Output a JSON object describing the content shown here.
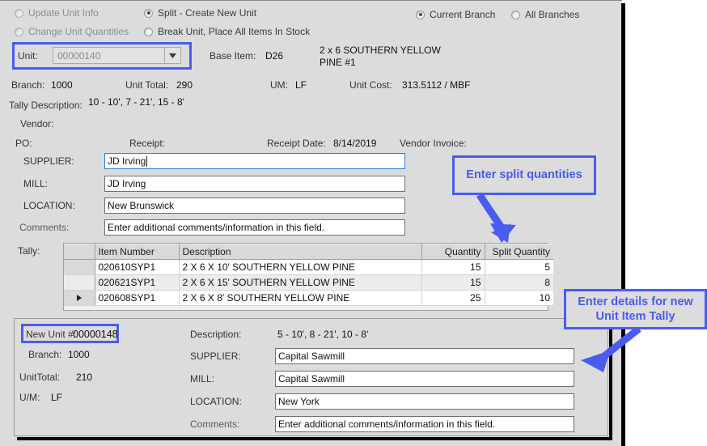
{
  "accent_color": "#4a5cf0",
  "mode_options": {
    "update_unit_info": "Update Unit Info",
    "change_unit_quantities": "Change Unit Quantities",
    "split_create_new_unit": "Split - Create New Unit",
    "break_unit": "Break Unit, Place All Items In Stock"
  },
  "branch_scope": {
    "current_branch": "Current Branch",
    "all_branches": "All Branches"
  },
  "unit_section": {
    "unit_label": "Unit:",
    "unit_value": "00000140",
    "base_item_label": "Base Item:",
    "base_item_value": "D26",
    "item_desc_line1": "2 x 6 SOUTHERN YELLOW",
    "item_desc_line2": "PINE #1"
  },
  "info_row": {
    "branch_label": "Branch:",
    "branch_value": "1000",
    "unit_total_label": "Unit Total:",
    "unit_total_value": "290",
    "um_label": "UM:",
    "um_value": "LF",
    "unit_cost_label": "Unit Cost:",
    "unit_cost_value": "313.5112 / MBF"
  },
  "tally_description": {
    "label": "Tally Description:",
    "value": "10 - 10', 7 - 21', 15 - 8'"
  },
  "vendor": {
    "vendor_label": "Vendor:",
    "po_label": "PO:",
    "po_value": "",
    "receipt_label": "Receipt:",
    "receipt_value": "",
    "receipt_date_label": "Receipt Date:",
    "receipt_date_value": "8/14/2019",
    "vendor_invoice_label": "Vendor Invoice:",
    "vendor_invoice_value": ""
  },
  "source_fields": {
    "supplier_label": "SUPPLIER:",
    "supplier_value": "JD Irving",
    "mill_label": "MILL:",
    "mill_value": "JD Irving",
    "location_label": "LOCATION:",
    "location_value": "New Brunswick",
    "comments_label": "Comments:",
    "comments_value": "Enter additional comments/information in this field."
  },
  "tally": {
    "label": "Tally:",
    "columns": [
      "",
      "Item Number",
      "Description",
      "Quantity",
      "Split Quantity"
    ],
    "rows": [
      {
        "selector": "",
        "item_number": "020610SYP1",
        "description": "2 X 6 X 10' SOUTHERN YELLOW PINE",
        "quantity": "15",
        "split_quantity": "5"
      },
      {
        "selector": "",
        "item_number": "020621SYP1",
        "description": "2 X 6 X 15' SOUTHERN YELLOW PINE",
        "quantity": "15",
        "split_quantity": "8"
      },
      {
        "selector": "▶",
        "item_number": "020608SYP1",
        "description": "2 X 6 X 8' SOUTHERN YELLOW PINE",
        "quantity": "25",
        "split_quantity": "10"
      }
    ]
  },
  "new_unit": {
    "new_unit_label": "New Unit #:",
    "new_unit_value": "00000148",
    "branch_label": "Branch:",
    "branch_value": "1000",
    "unit_total_label": "UnitTotal:",
    "unit_total_value": "210",
    "um_label": "U/M:",
    "um_value": "LF",
    "description_label": "Description:",
    "description_value": "5 - 10', 8 - 21', 10 - 8'",
    "supplier_label": "SUPPLIER:",
    "supplier_value": "Capital Sawmill",
    "mill_label": "MILL:",
    "mill_value": "Capital Sawmill",
    "location_label": "LOCATION:",
    "location_value": "New York",
    "comments_label": "Comments:",
    "comments_value": "Enter additional comments/information in this field."
  },
  "callouts": {
    "split_quantities": "Enter split quantities",
    "new_unit_details_line1": "Enter details for new",
    "new_unit_details_line2": "Unit Item Tally"
  }
}
